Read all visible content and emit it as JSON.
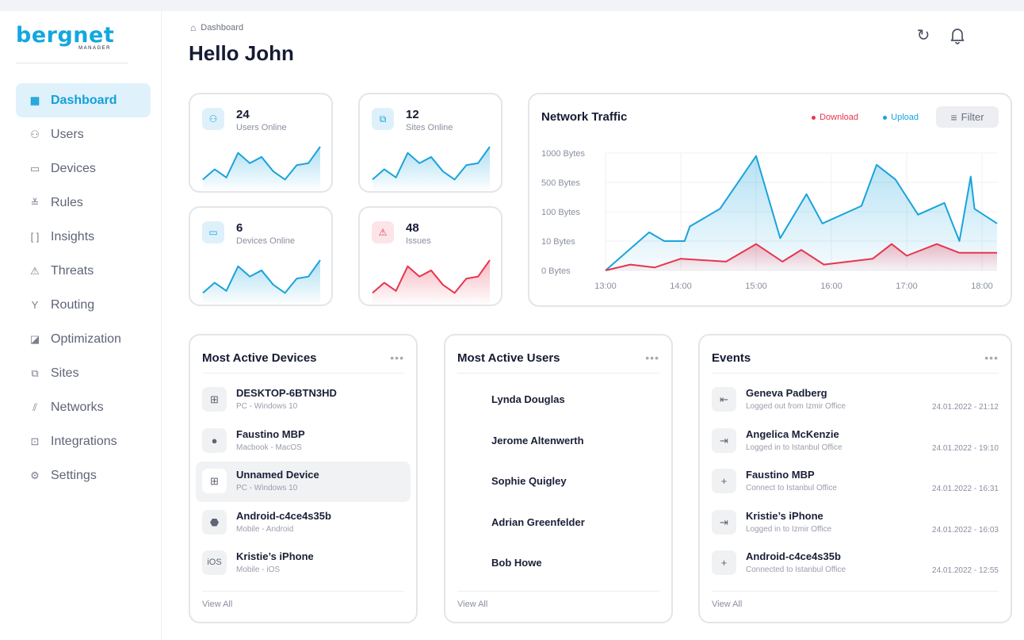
{
  "brand": {
    "name": "bergnet",
    "sub": "MANAGER"
  },
  "sidebar": {
    "items": [
      {
        "label": "Dashboard",
        "icon": "dashboard-icon",
        "glyph": "▦",
        "active": true
      },
      {
        "label": "Users",
        "icon": "users-icon",
        "glyph": "⚇"
      },
      {
        "label": "Devices",
        "icon": "devices-icon",
        "glyph": "▭"
      },
      {
        "label": "Rules",
        "icon": "rules-icon",
        "glyph": "≚"
      },
      {
        "label": "Insights",
        "icon": "insights-icon",
        "glyph": "[ ]"
      },
      {
        "label": "Threats",
        "icon": "threats-icon",
        "glyph": "⚠"
      },
      {
        "label": "Routing",
        "icon": "routing-icon",
        "glyph": "Y"
      },
      {
        "label": "Optimization",
        "icon": "optimization-icon",
        "glyph": "◪"
      },
      {
        "label": "Sites",
        "icon": "sites-icon",
        "glyph": "⧉"
      },
      {
        "label": "Networks",
        "icon": "networks-icon",
        "glyph": "⫽"
      },
      {
        "label": "Integrations",
        "icon": "integrations-icon",
        "glyph": "⊡"
      },
      {
        "label": "Settings",
        "icon": "settings-icon",
        "glyph": "⚙"
      }
    ]
  },
  "header": {
    "breadcrumb": "Dashboard",
    "title": "Hello John"
  },
  "stats": [
    {
      "value": "24",
      "label": "Users Online",
      "icon": "users-icon",
      "glyph": "⚇",
      "color": "#1aa3dc",
      "trend": [
        1,
        6,
        2,
        14,
        9,
        12,
        5,
        1,
        8,
        9,
        17
      ]
    },
    {
      "value": "12",
      "label": "Sites Online",
      "icon": "sites-icon",
      "glyph": "⧉",
      "color": "#1aa3dc",
      "trend": [
        1,
        6,
        2,
        14,
        9,
        12,
        5,
        1,
        8,
        9,
        17
      ]
    },
    {
      "value": "6",
      "label": "Devices Online",
      "icon": "devices-icon",
      "glyph": "▭",
      "color": "#1aa3dc",
      "trend": [
        1,
        6,
        2,
        14,
        9,
        12,
        5,
        1,
        8,
        9,
        17
      ]
    },
    {
      "value": "48",
      "label": "Issues",
      "icon": "warning-icon",
      "glyph": "⚠",
      "color": "#e8354f",
      "trend": [
        1,
        6,
        2,
        14,
        9,
        12,
        5,
        1,
        8,
        9,
        17
      ]
    }
  ],
  "chart_data": {
    "type": "area",
    "title": "Network Traffic",
    "y_tick_labels": [
      "1000 Bytes",
      "500 Bytes",
      "100 Bytes",
      "10 Bytes",
      "0 Bytes"
    ],
    "x_tick_labels": [
      "13:00",
      "14:00",
      "15:00",
      "16:00",
      "17:00",
      "18:00"
    ],
    "ylim": [
      0,
      4
    ],
    "xlim": [
      0,
      5.2
    ],
    "grid": true,
    "legend_position": "top-right",
    "series": [
      {
        "name": "Download",
        "color": "#e8354f",
        "x": [
          0,
          0.33,
          0.65,
          1.0,
          1.6,
          2.0,
          2.35,
          2.6,
          2.9,
          3.55,
          3.8,
          4.0,
          4.4,
          4.7,
          5.2
        ],
        "y": [
          0,
          0.2,
          0.1,
          0.4,
          0.3,
          0.9,
          0.3,
          0.7,
          0.2,
          0.4,
          0.9,
          0.5,
          0.9,
          0.6,
          0.6
        ]
      },
      {
        "name": "Upload",
        "color": "#1aa3dc",
        "x": [
          0,
          0.58,
          0.78,
          1.05,
          1.12,
          1.52,
          2.0,
          2.32,
          2.67,
          2.88,
          3.4,
          3.6,
          3.85,
          4.15,
          4.5,
          4.7,
          4.85,
          4.9,
          5.2
        ],
        "y": [
          0,
          1.3,
          1.0,
          1.0,
          1.5,
          2.1,
          3.9,
          1.1,
          2.6,
          1.6,
          2.2,
          3.6,
          3.1,
          1.9,
          2.3,
          1.0,
          3.2,
          2.1,
          1.6
        ]
      }
    ]
  },
  "filter_label": "Filter",
  "devices": {
    "title": "Most Active Devices",
    "view_all": "View All",
    "items": [
      {
        "name": "DESKTOP-6BTN3HD",
        "sub": "PC - Windows 10",
        "icon": "windows-icon",
        "glyph": "⊞"
      },
      {
        "name": "Faustino MBP",
        "sub": "Macbook - MacOS",
        "icon": "apple-icon",
        "glyph": "●"
      },
      {
        "name": "Unnamed Device",
        "sub": "PC - Windows 10",
        "icon": "windows-icon",
        "glyph": "⊞",
        "highlighted": true
      },
      {
        "name": "Android-c4ce4s35b",
        "sub": "Mobile - Android",
        "icon": "android-icon",
        "glyph": "⬣"
      },
      {
        "name": "Kristie’s iPhone",
        "sub": "Mobile - iOS",
        "icon": "ios-icon",
        "glyph": "iOS"
      }
    ]
  },
  "users": {
    "title": "Most Active Users",
    "view_all": "View All",
    "items": [
      "Lynda Douglas",
      "Jerome Altenwerth",
      "Sophie Quigley",
      "Adrian Greenfelder",
      "Bob Howe"
    ]
  },
  "events": {
    "title": "Events",
    "view_all": "View All",
    "items": [
      {
        "name": "Geneva Padberg",
        "sub": "Logged out from Izmir Office",
        "time": "24.01.2022 - 21:12",
        "icon": "logout-icon",
        "glyph": "⇤"
      },
      {
        "name": "Angelica McKenzie",
        "sub": "Logged in to Istanbul Office",
        "time": "24.01.2022 - 19:10",
        "icon": "login-icon",
        "glyph": "⇥"
      },
      {
        "name": "Faustino MBP",
        "sub": "Connect to Istanbul Office",
        "time": "24.01.2022 - 16:31",
        "icon": "plus-icon",
        "glyph": "+"
      },
      {
        "name": "Kristie’s iPhone",
        "sub": "Logged in to Izmir Office",
        "time": "24.01.2022 - 16:03",
        "icon": "login-icon",
        "glyph": "⇥"
      },
      {
        "name": "Android-c4ce4s35b",
        "sub": "Connected to Istanbul Office",
        "time": "24.01.2022 - 12:55",
        "icon": "plus-icon",
        "glyph": "+"
      }
    ]
  }
}
